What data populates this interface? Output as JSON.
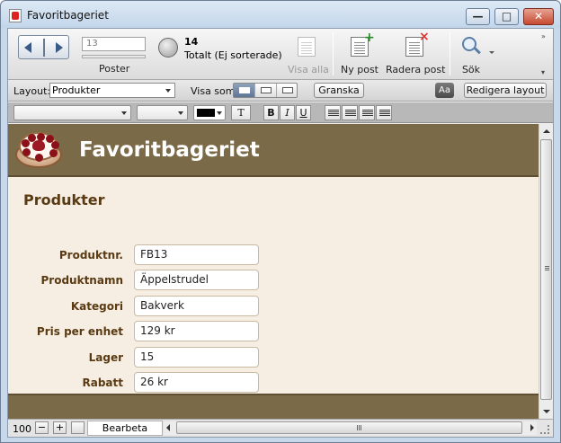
{
  "window": {
    "title": "Favoritbageriet",
    "controls": {
      "minimize": "—",
      "maximize": "□",
      "close": "✕"
    }
  },
  "toolbar": {
    "record_input_value": "13",
    "records_label": "Poster",
    "found_count": "14",
    "found_label": "Totalt (Ej sorterade)",
    "show_all_label": "Visa alla",
    "new_record_label": "Ny post",
    "delete_record_label": "Radera post",
    "find_label": "Sök",
    "overflow": "»",
    "collapse": "▾"
  },
  "layoutbar": {
    "layout_label": "Layout:",
    "layout_value": "Produkter",
    "view_as_label": "Visa som:",
    "preview_label": "Granska",
    "aa_label": "Aa",
    "edit_layout_label": "Redigera layout"
  },
  "formatbar": {
    "text_label": "T",
    "bold_label": "B",
    "italic_label": "I",
    "underline_label": "U"
  },
  "form": {
    "header_title": "Favoritbageriet",
    "section_title": "Produkter",
    "fields": [
      {
        "label": "Produktnr.",
        "value": "FB13"
      },
      {
        "label": "Produktnamn",
        "value": "Äppelstrudel"
      },
      {
        "label": "Kategori",
        "value": "Bakverk"
      },
      {
        "label": "Pris per enhet",
        "value": "129 kr"
      },
      {
        "label": "Lager",
        "value": "15"
      },
      {
        "label": "Rabatt",
        "value": "26 kr"
      }
    ]
  },
  "statusbar": {
    "zoom": "100",
    "zoom_out": "−",
    "zoom_in": "+",
    "mode": "Bearbeta"
  },
  "colors": {
    "header_band": "#7b6a48",
    "label_text": "#5a3a12",
    "content_bg": "#f6eee3"
  }
}
